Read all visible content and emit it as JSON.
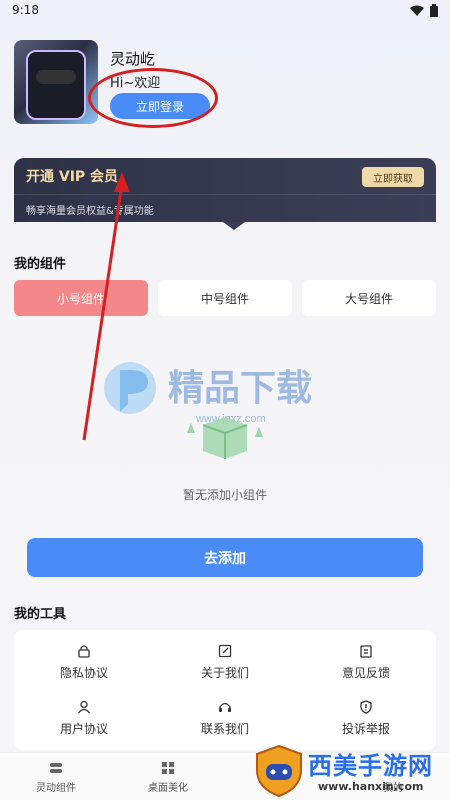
{
  "status": {
    "time": "9:18"
  },
  "profile": {
    "app_name": "灵动屹",
    "welcome": "Hi~欢迎",
    "login_label": "立即登录"
  },
  "vip": {
    "title": "开通 VIP 会员",
    "subtitle": "畅享海量会员权益&专属功能",
    "button_label": "立即获取"
  },
  "widgets": {
    "section_title": "我的组件",
    "tabs": [
      {
        "label": "小号组件"
      },
      {
        "label": "中号组件"
      },
      {
        "label": "大号组件"
      }
    ],
    "empty_text": "暂无添加小组件",
    "add_label": "去添加"
  },
  "watermark": {
    "text": "精品下载",
    "url": "www.jpxz.com"
  },
  "tools": {
    "section_title": "我的工具",
    "items": [
      {
        "label": "隐私协议",
        "icon": "lock-icon"
      },
      {
        "label": "关于我们",
        "icon": "edit-icon"
      },
      {
        "label": "意见反馈",
        "icon": "clipboard-icon"
      },
      {
        "label": "用户协议",
        "icon": "user-icon"
      },
      {
        "label": "联系我们",
        "icon": "headset-icon"
      },
      {
        "label": "投诉举报",
        "icon": "shield-alert-icon"
      }
    ]
  },
  "nav": {
    "items": [
      {
        "label": "灵动组件",
        "icon": "toggle-icon"
      },
      {
        "label": "桌面美化",
        "icon": "grid-icon"
      },
      {
        "label": "我的",
        "icon": "user-icon"
      }
    ]
  },
  "site_badge": {
    "text": "西美手游网",
    "url": "www.hanxin.com"
  },
  "colors": {
    "accent": "#4a8cf7",
    "active_tab": "#f3878a",
    "vip_bg": "#2f3247",
    "vip_gold": "#f2d8a4",
    "annotation": "#d42020"
  }
}
